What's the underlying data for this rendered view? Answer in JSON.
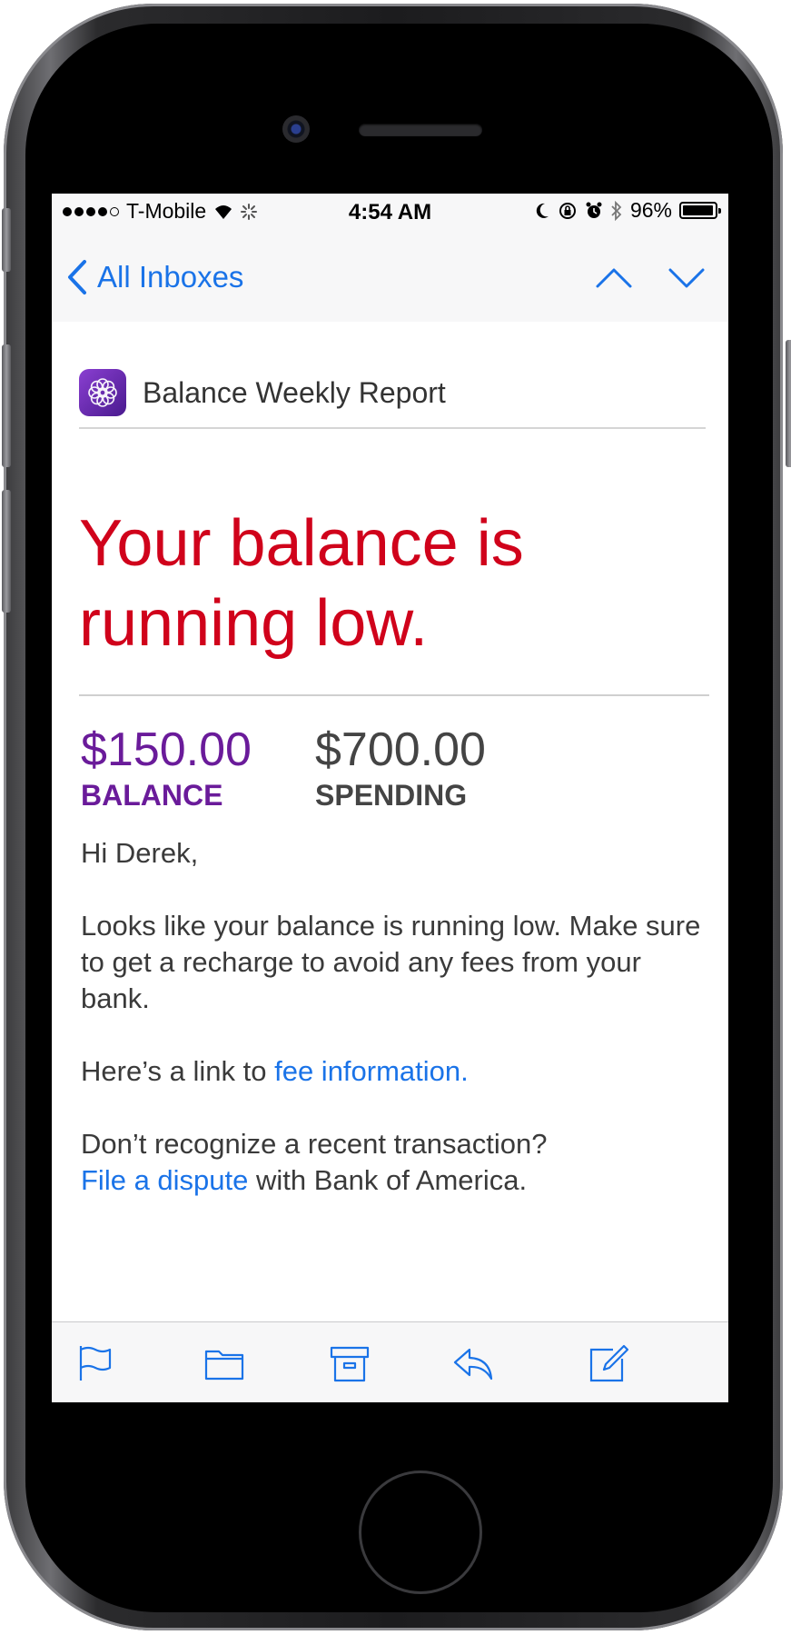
{
  "status_bar": {
    "carrier": "T-Mobile",
    "time": "4:54 AM",
    "battery_percent": "96%",
    "battery_level": 0.96
  },
  "nav": {
    "back_label": "All Inboxes"
  },
  "mail": {
    "subject": "Balance Weekly Report",
    "headline": "Your balance is running low.",
    "balance_value": "$150.00",
    "balance_label": "BALANCE",
    "spending_value": "$700.00",
    "spending_label": "SPENDING",
    "greeting": "Hi Derek,",
    "paragraph1": "Looks like your balance is running low. Make sure to get a recharge to avoid any fees from your bank.",
    "link_intro": "Here’s a link to ",
    "fee_link": "fee information.",
    "dispute_question": "Don’t recognize a recent transaction?",
    "dispute_link": "File a dispute",
    "dispute_suffix": " with Bank of America."
  },
  "colors": {
    "accent": "#1a73e8",
    "headline": "#d0021b",
    "balance": "#6a1b9a"
  },
  "icons": {
    "toolbar": [
      "flag-icon",
      "folder-icon",
      "archive-icon",
      "reply-icon",
      "compose-icon"
    ]
  }
}
